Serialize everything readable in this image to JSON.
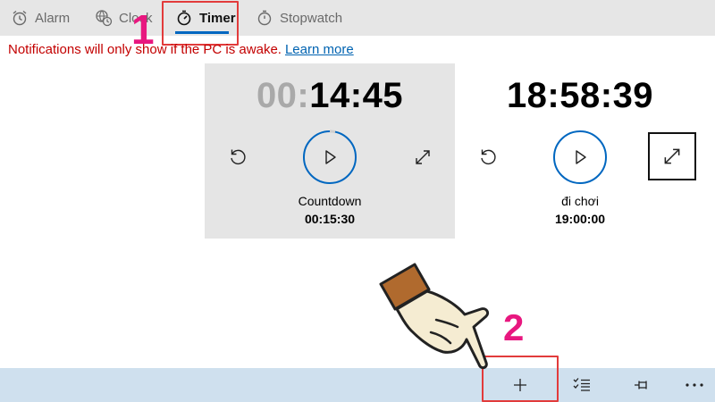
{
  "tabs": [
    {
      "label": "Alarm",
      "icon": "alarm-clock-icon",
      "active": false
    },
    {
      "label": "Clock",
      "icon": "world-clock-icon",
      "active": false
    },
    {
      "label": "Timer",
      "icon": "timer-icon",
      "active": true
    },
    {
      "label": "Stopwatch",
      "icon": "stopwatch-icon",
      "active": false
    }
  ],
  "annotations": {
    "step1": "1",
    "step2": "2"
  },
  "notification": {
    "text": "Notifications will only show if the PC is awake.",
    "link": "Learn more"
  },
  "timers": [
    {
      "display_dim": "00:",
      "display_main": "14:45",
      "name": "Countdown",
      "duration": "00:15:30",
      "selected": true
    },
    {
      "display_dim": "",
      "display_main": "18:58:39",
      "name": "đi chơi",
      "duration": "19:00:00",
      "selected": false
    }
  ],
  "commands": [
    {
      "name": "add-timer",
      "icon": "plus-icon"
    },
    {
      "name": "select-timers",
      "icon": "checklist-icon"
    },
    {
      "name": "pin",
      "icon": "pin-icon"
    },
    {
      "name": "more",
      "icon": "more-icon"
    }
  ],
  "colors": {
    "accent": "#0067c0",
    "notice": "#c30000",
    "link": "#0063b1",
    "highlight_box": "#e23b3b",
    "step_number": "#e8177f",
    "command_bar": "#cfe0ee"
  }
}
